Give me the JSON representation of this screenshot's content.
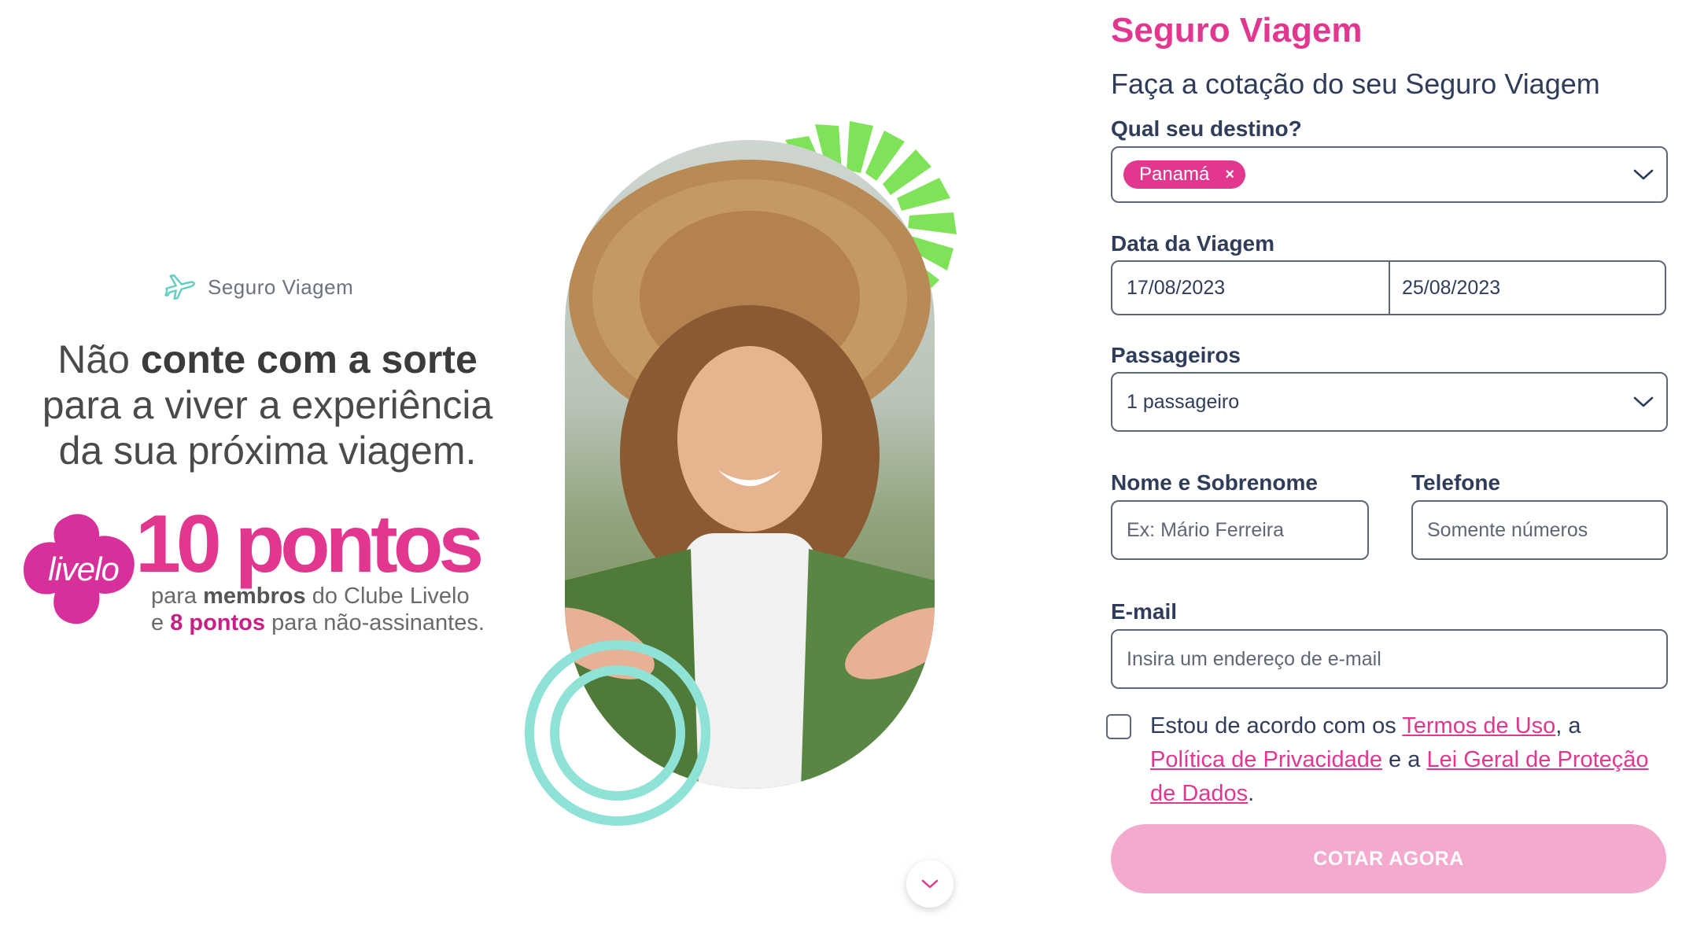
{
  "banner": {
    "brand_label": "Seguro Viagem",
    "headline": {
      "line1_pre": "Não ",
      "line1_bold": "conte com a sorte",
      "line2": "para a viver a experiência",
      "line3": "da sua próxima viagem."
    },
    "livelo_logo_text": "livelo",
    "points_big": "10 pontos",
    "points_line1": {
      "pre": "para ",
      "bold": "membros",
      "post": " do Clube Livelo"
    },
    "points_line2": {
      "pre": "e ",
      "bold": "8 pontos",
      "post": " para não-assinantes."
    }
  },
  "form": {
    "title": "Seguro Viagem",
    "subtitle": "Faça a cotação do seu Seguro Viagem",
    "destination": {
      "label": "Qual seu destino?",
      "chips": [
        {
          "label": "Panamá",
          "remove": "×"
        }
      ]
    },
    "dates": {
      "label": "Data da Viagem",
      "start": "17/08/2023",
      "end": "25/08/2023"
    },
    "passengers": {
      "label": "Passageiros",
      "value": "1 passageiro"
    },
    "name": {
      "label": "Nome e Sobrenome",
      "placeholder": "Ex: Mário Ferreira"
    },
    "phone": {
      "label": "Telefone",
      "placeholder": "Somente números"
    },
    "email": {
      "label": "E-mail",
      "placeholder": "Insira um endereço de e-mail"
    },
    "consent": {
      "checked": false,
      "text1": "Estou de acordo com os ",
      "link_terms": "Termos de Uso",
      "text2": ", a ",
      "link_privacy": "Política de Privacidade",
      "text3": " e a ",
      "link_lgpd": "Lei Geral de Proteção de Dados",
      "text4": "."
    },
    "submit_label": "COTAR AGORA"
  },
  "colors": {
    "brand_pink": "#e2378f",
    "button_disabled": "#f4a9cf",
    "accent_green": "#7fe35a",
    "accent_teal": "#8fe3d6",
    "text_dark": "#2f3d5a"
  },
  "icons": {
    "brand": "airplane-icon",
    "dropdown": "chevron-down-icon",
    "scroll": "chevron-down-icon",
    "chip_remove": "close-icon"
  }
}
